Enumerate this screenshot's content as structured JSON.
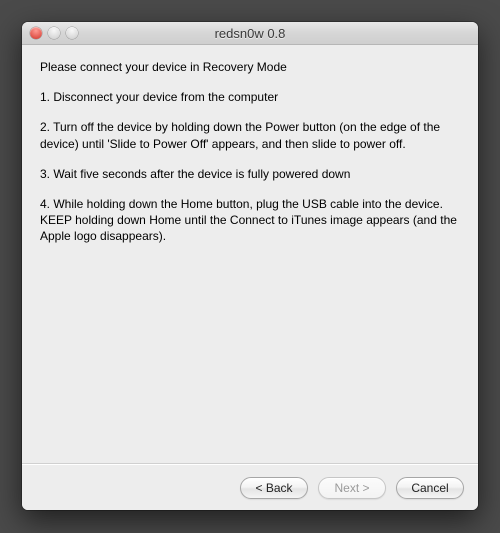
{
  "window": {
    "title": "redsn0w 0.8"
  },
  "content": {
    "intro": "Please connect your device in Recovery Mode",
    "step1": "1. Disconnect your device from the computer",
    "step2": "2. Turn off the device by holding down the Power button (on the edge of the device) until 'Slide to Power Off' appears, and then slide to power off.",
    "step3": "3. Wait five seconds after the device is fully powered down",
    "step4": "4. While holding down the Home button, plug the USB cable into the device. KEEP holding down Home until the Connect to iTunes image appears (and the Apple logo disappears)."
  },
  "buttons": {
    "back": "< Back",
    "next": "Next >",
    "cancel": "Cancel"
  }
}
